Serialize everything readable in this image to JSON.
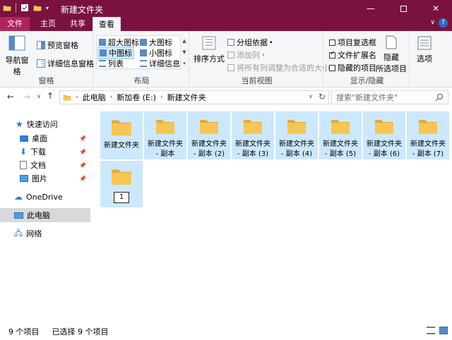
{
  "window": {
    "title": "新建文件夹"
  },
  "tabs": [
    {
      "label": "文件"
    },
    {
      "label": "主页"
    },
    {
      "label": "共享"
    },
    {
      "label": "查看"
    }
  ],
  "ribbon": {
    "pane": {
      "nav_pane": "导航窗格",
      "preview_pane": "预览窗格",
      "details_pane": "详细信息窗格",
      "group_label": "窗格"
    },
    "layout": {
      "items": [
        "超大图标",
        "大图标",
        "中图标",
        "小图标",
        "列表",
        "详细信息"
      ],
      "selected": "中图标",
      "group_label": "布局"
    },
    "current_view": {
      "sort_by": "排序方式",
      "group_by": "分组依据",
      "add_column": "添加列",
      "fit_columns": "将所有列调整为合适的大小",
      "group_label": "当前视图"
    },
    "show_hide": {
      "item_checkboxes": "项目复选框",
      "file_extensions": "文件扩展名",
      "hidden_items": "隐藏的项目",
      "hide_selected_line1": "隐藏",
      "hide_selected_line2": "所选项目",
      "group_label": "显示/隐藏"
    },
    "options": "选项"
  },
  "address": {
    "breadcrumbs": [
      "此电脑",
      "新加卷 (E:)",
      "新建文件夹"
    ],
    "search_placeholder": "搜索\"新建文件夹\""
  },
  "nav": {
    "quick_access": "快速访问",
    "items": [
      "桌面",
      "下载",
      "文档",
      "图片"
    ],
    "onedrive": "OneDrive",
    "this_pc": "此电脑",
    "network": "网络"
  },
  "files": [
    {
      "line1": "新建文件夹",
      "line2": ""
    },
    {
      "line1": "新建文件夹",
      "line2": "- 副本"
    },
    {
      "line1": "新建文件夹",
      "line2": "- 副本 (2)"
    },
    {
      "line1": "新建文件夹",
      "line2": "- 副本 (3)"
    },
    {
      "line1": "新建文件夹",
      "line2": "- 副本 (4)"
    },
    {
      "line1": "新建文件夹",
      "line2": "- 副本 (5)"
    },
    {
      "line1": "新建文件夹",
      "line2": "- 副本 (6)"
    },
    {
      "line1": "新建文件夹",
      "line2": "- 副本 (7)"
    }
  ],
  "rename_value": "1",
  "status": {
    "item_count": "9 个项目",
    "selected_count": "已选择 9 个项目"
  },
  "colors": {
    "titlebar": "#7a1240",
    "selection": "#cce8ff",
    "folder": "#f6c652"
  }
}
